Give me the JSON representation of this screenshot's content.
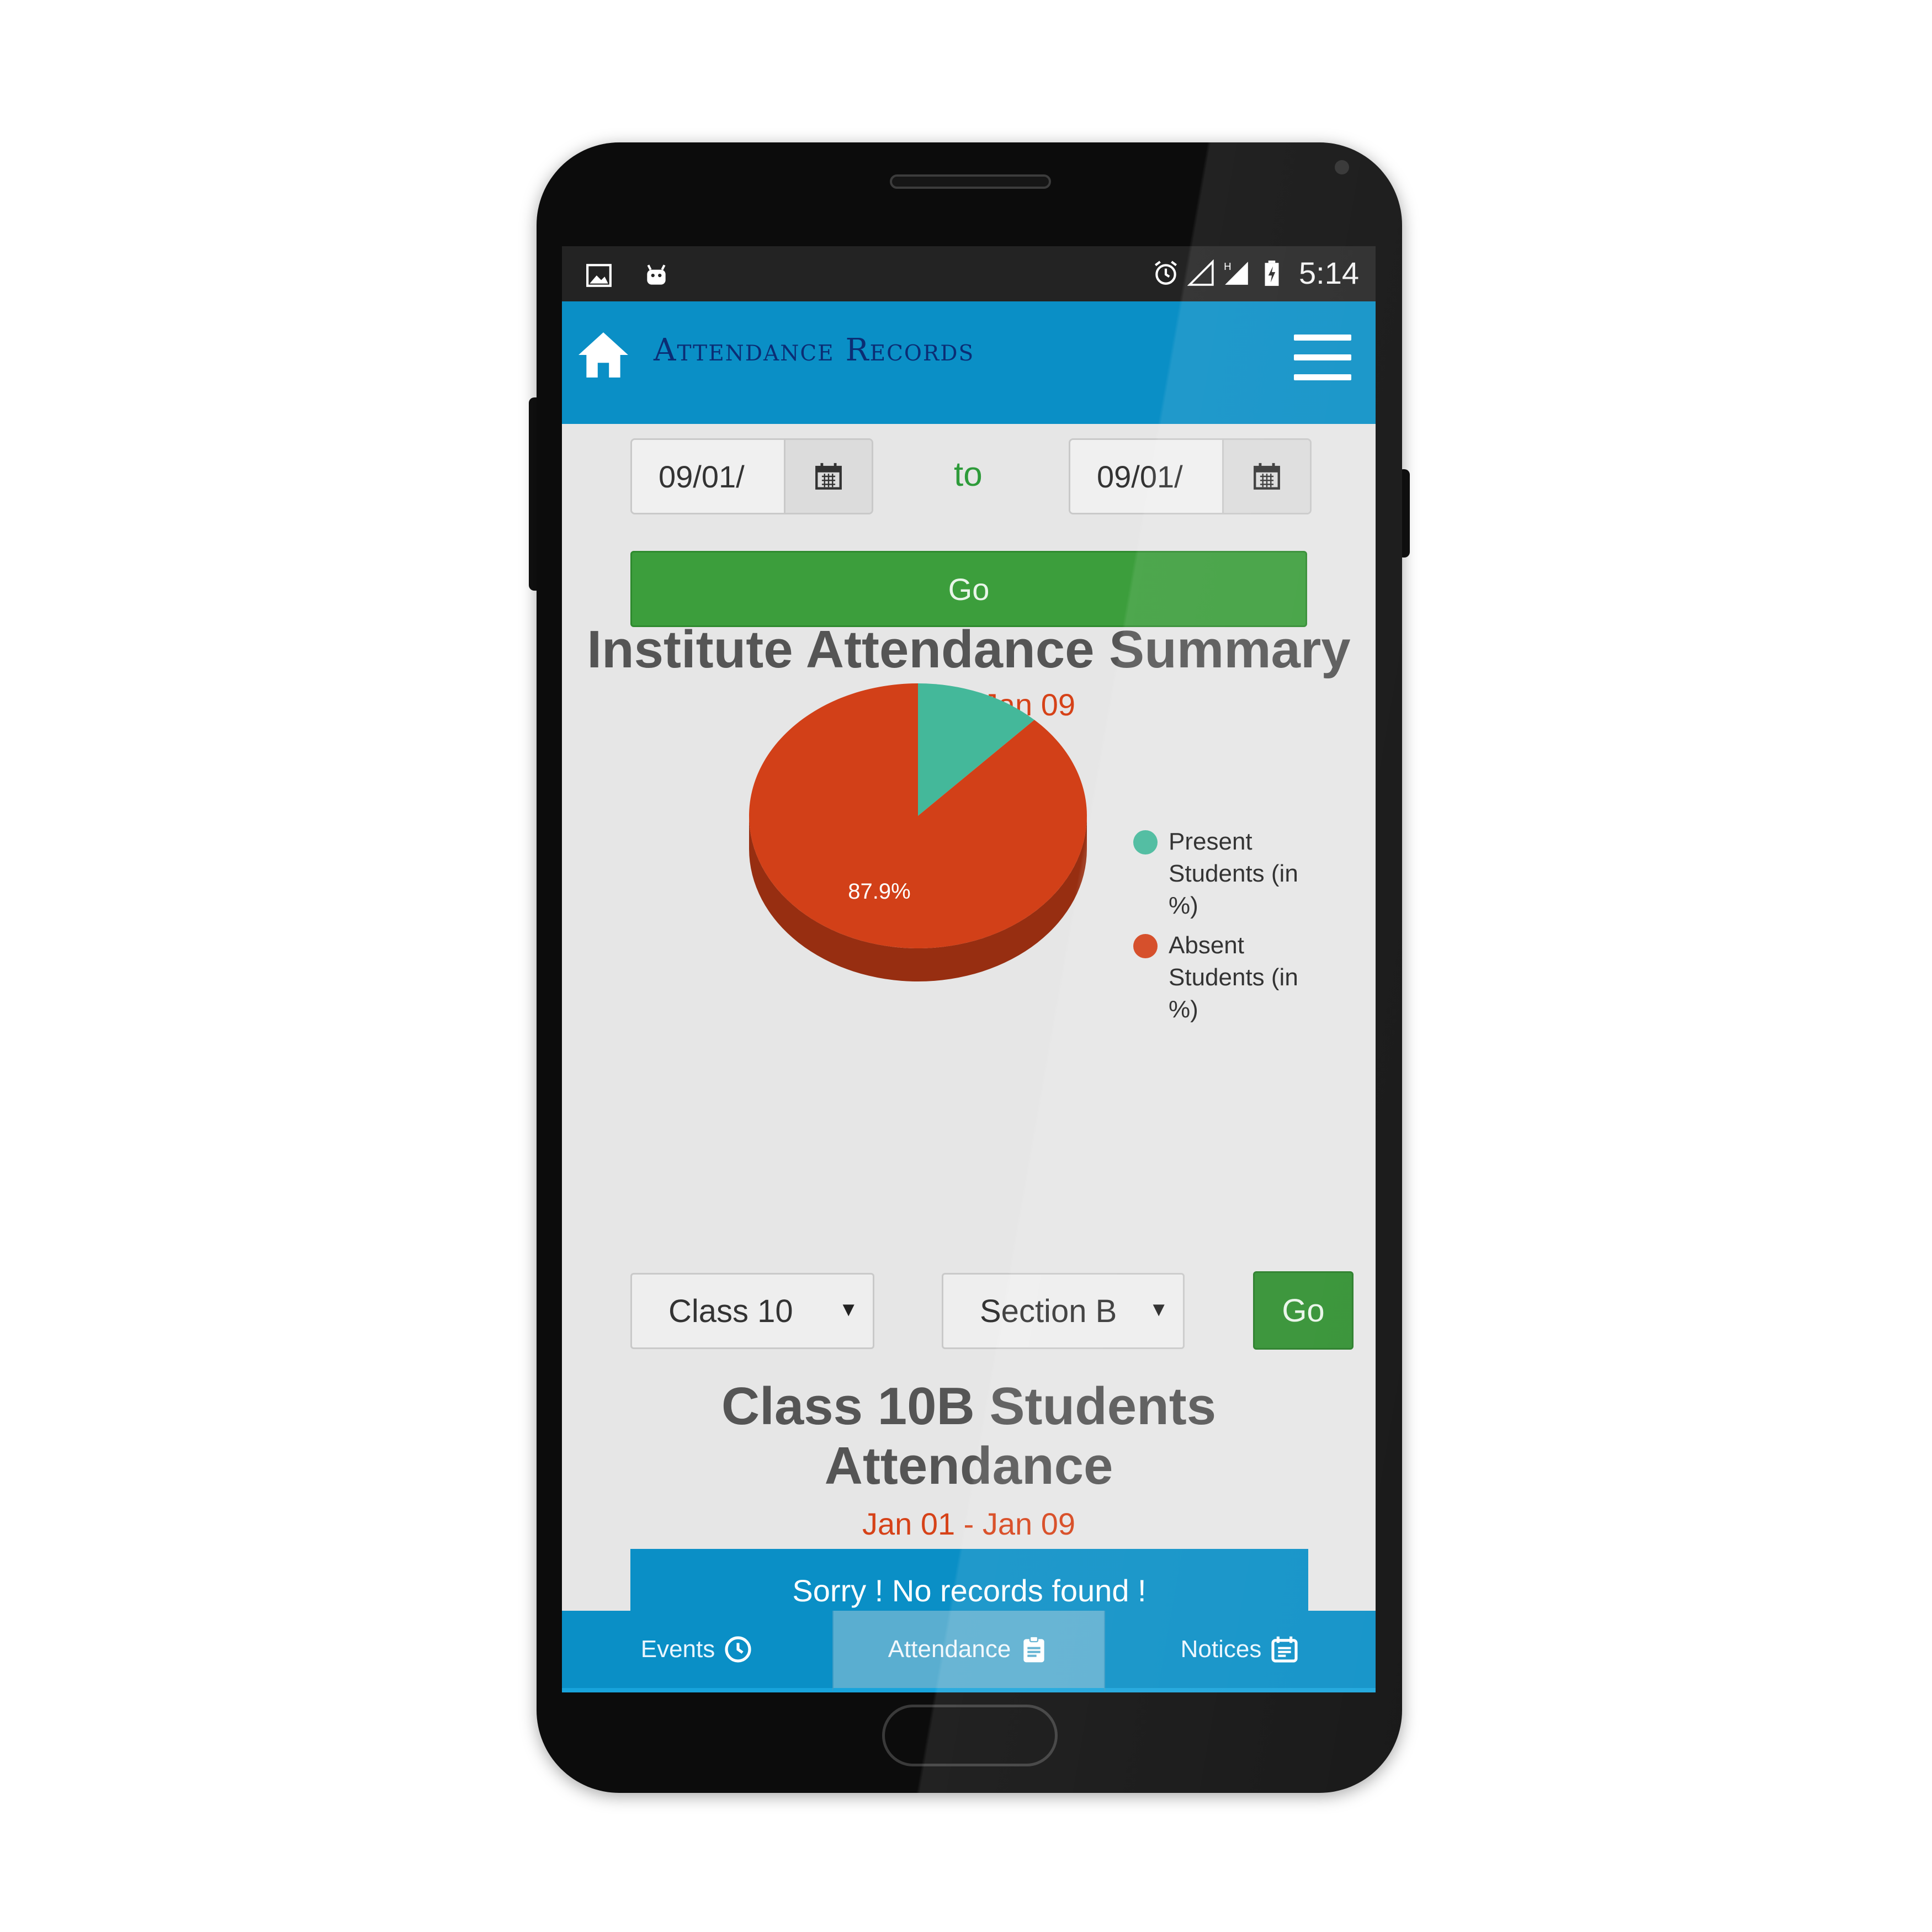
{
  "status_bar": {
    "time": "5:14",
    "left_icons": [
      "image-icon",
      "android-icon"
    ],
    "right_icons": [
      "alarm-icon",
      "signal-empty-icon",
      "signal-h-icon",
      "battery-charging-icon"
    ],
    "network_type": "H"
  },
  "app_bar": {
    "title": "Attendance Records",
    "icons": [
      "home-icon",
      "hamburger-menu-icon"
    ]
  },
  "date_range": {
    "from_value": "09/01/",
    "separator": "to",
    "to_value": "09/01/",
    "submit_label": "Go"
  },
  "summary": {
    "title": "Institute Attendance Summary",
    "range": "Jan 01 - Jan 09"
  },
  "chart_data": {
    "type": "pie",
    "slices": [
      {
        "label": "Present Students (in %)",
        "value": 12.1,
        "color": "#44b89a"
      },
      {
        "label": "Absent Students (in %)",
        "value": 87.9,
        "color": "#d24018"
      }
    ],
    "data_labels": [
      "87.9%"
    ],
    "legend_position": "right",
    "style": "3d"
  },
  "filters": {
    "class_selected": "Class 10",
    "section_selected": "Section B",
    "submit_label": "Go"
  },
  "class_summary": {
    "title": "Class 10B Students Attendance",
    "range": "Jan 01 - Jan 09",
    "empty_message": "Sorry ! No records found !"
  },
  "bottom_nav": {
    "tabs": [
      {
        "label": "Events",
        "icon": "clock-icon",
        "active": false
      },
      {
        "label": "Attendance",
        "icon": "clipboard-icon",
        "active": true
      },
      {
        "label": "Notices",
        "icon": "calendar-note-icon",
        "active": false
      }
    ]
  },
  "colors": {
    "primary": "#0a8fc6",
    "title_text": "#0b2d74",
    "go_button": "#3c9e3c",
    "accent_red": "#d64218",
    "to_label": "#2e9b3a"
  }
}
